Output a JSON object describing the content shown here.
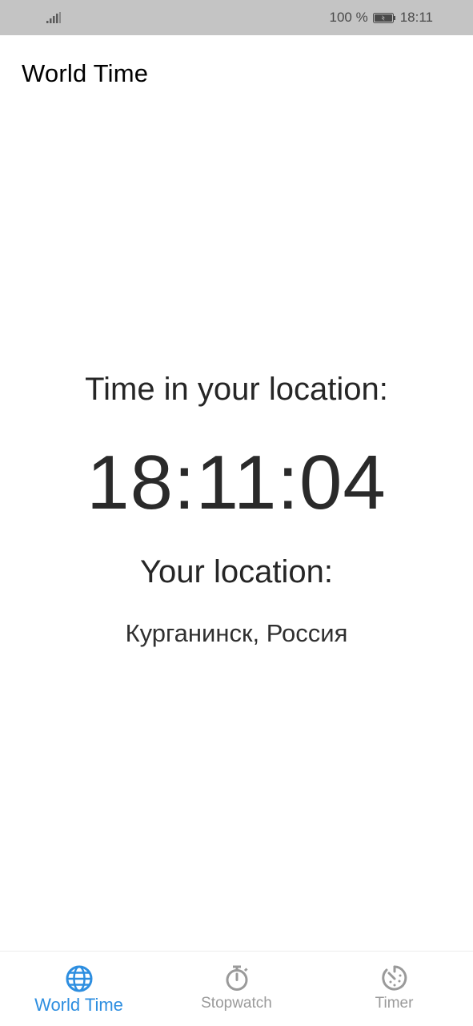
{
  "status_bar": {
    "battery_percent": "100 %",
    "time": "18:11",
    "icons": [
      "signal-icon",
      "battery-icon"
    ]
  },
  "app_title": "World Time",
  "main": {
    "time_heading": "Time in your location:",
    "current_time": "18:11:04",
    "location_heading": "Your location:",
    "location_value": "Курганинск, Россия"
  },
  "bottom_nav": {
    "items": [
      {
        "label": "World Time",
        "icon": "globe-icon",
        "active": true
      },
      {
        "label": "Stopwatch",
        "icon": "stopwatch-icon",
        "active": false
      },
      {
        "label": "Timer",
        "icon": "timer-icon",
        "active": false
      }
    ],
    "active_color": "#2d8ee0",
    "inactive_color": "#9a9a9a"
  },
  "colors": {
    "status_bar_bg": "#c4c4c4",
    "background": "#ffffff"
  }
}
